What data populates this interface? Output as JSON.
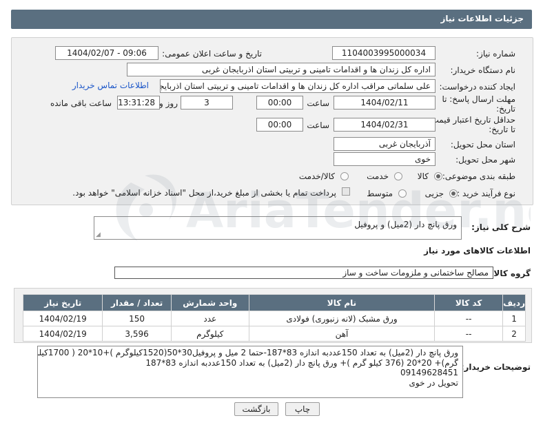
{
  "header": {
    "title": "جزئیات اطلاعات نیاز"
  },
  "form": {
    "need_number_label": "شماره نیاز:",
    "need_number": "1104003995000034",
    "announce_label": "تاریخ و ساعت اعلان عمومی:",
    "announce_value": "1404/02/07 - 09:06",
    "buyer_org_label": "نام دستگاه خریدار:",
    "buyer_org": "اداره کل زندان ها و اقدامات تامینی و تربیتی استان اذربایجان غربی",
    "creator_label": "ایجاد کننده درخواست:",
    "creator": "علی سلماتی مراقب اداره کل زندان ها و اقدامات تامینی و تربیتی استان اذربایجا",
    "contact_link": "اطلاعات تماس خریدار",
    "reply_deadline_label_1": "مهلت ارسال پاسخ: تا",
    "reply_deadline_label_2": "تاریخ:",
    "reply_date": "1404/02/11",
    "time_label": "ساعت",
    "reply_time": "00:00",
    "days_value": "3",
    "days_label": "روز و",
    "remaining_time": "13:31:28",
    "remaining_label": "ساعت باقی مانده",
    "price_validity_label_1": "حداقل تاریخ اعتبار قیمت:",
    "price_validity_label_2": "تا تاریخ:",
    "price_date": "1404/02/31",
    "price_time": "00:00",
    "delivery_province_label": "استان محل تحویل:",
    "delivery_province": "آذربایجان غربی",
    "delivery_city_label": "شهر محل تحویل:",
    "delivery_city": "خوی",
    "category_label": "طبقه بندی موضوعی:",
    "category_options": [
      "کالا",
      "خدمت",
      "کالا/خدمت"
    ],
    "category_selected": "کالا",
    "process_label": "نوع فرآیند خرید :",
    "process_options": [
      "جزیی",
      "متوسط"
    ],
    "process_selected": "جزیی",
    "payment_note": "پرداخت تمام یا بخشی از مبلغ خرید،از محل \"اسناد خزانه اسلامی\" خواهد بود."
  },
  "summary": {
    "label": "شرح کلی نیاز:",
    "value": "ورق پانچ دار (2میل)  و پروفیل"
  },
  "goods": {
    "section_title": "اطلاعات کالاهای مورد نیاز",
    "group_label": "گروه کالا:",
    "group_value": "مصالح ساختمانی و ملزومات ساخت و ساز",
    "columns": [
      "ردیف",
      "کد کالا",
      "نام کالا",
      "واحد شمارش",
      "تعداد / مقدار",
      "تاریخ نیاز"
    ],
    "rows": [
      {
        "index": "1",
        "code": "--",
        "name": "ورق مشبک (لانه زنبوری) فولادی",
        "unit": "عدد",
        "qty": "150",
        "date": "1404/02/19"
      },
      {
        "index": "2",
        "code": "--",
        "name": "آهن",
        "unit": "کیلوگرم",
        "qty": "3,596",
        "date": "1404/02/19"
      }
    ]
  },
  "notes": {
    "label": "توضیحات خریدار:",
    "lines": [
      "ورق پانچ دار (2میل) به تعداد 150عددبه اندازه 83*187-حتما 2 میل  و پروفیل30*50(1520کیلوگرم )+10*20 ( 1700کیلو",
      "گرم)+ 20*20 (376 کیلو گرم )+ ورق پانچ دار (2میل) به تعداد  150عددبه اندازه 83*187",
      "09149628451",
      "تحویل در خوی"
    ]
  },
  "buttons": {
    "print": "چاپ",
    "back": "بازگشت"
  },
  "watermark": {
    "text": "AriaTender.net"
  }
}
